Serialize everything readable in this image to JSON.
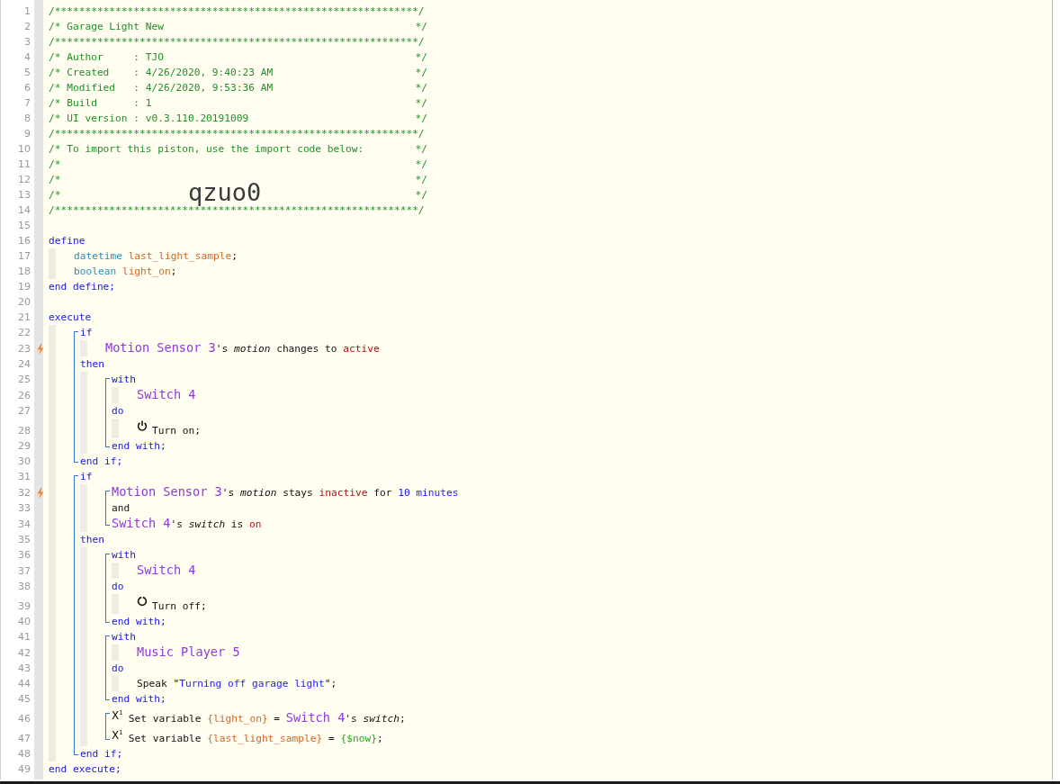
{
  "lines": [
    {
      "kind": "comment",
      "number": "1",
      "text": "/************************************************************/"
    },
    {
      "kind": "comment",
      "number": "2",
      "text": "/* Garage Light New",
      "close": "*/"
    },
    {
      "kind": "comment",
      "number": "3",
      "text": "/************************************************************/"
    },
    {
      "kind": "comment",
      "number": "4",
      "text": "/* Author     : TJO",
      "close": "*/"
    },
    {
      "kind": "comment",
      "number": "5",
      "text": "/* Created    : 4/26/2020, 9:40:23 AM",
      "close": "*/"
    },
    {
      "kind": "comment",
      "number": "6",
      "text": "/* Modified   : 4/26/2020, 9:53:36 AM",
      "close": "*/"
    },
    {
      "kind": "comment",
      "number": "7",
      "text": "/* Build      : 1",
      "close": "*/"
    },
    {
      "kind": "comment",
      "number": "8",
      "text": "/* UI version : v0.3.110.20191009",
      "close": "*/"
    },
    {
      "kind": "comment",
      "number": "9",
      "text": "/************************************************************/"
    },
    {
      "kind": "comment",
      "number": "10",
      "text": "/* To import this piston, use the import code below:",
      "close": "*/"
    },
    {
      "kind": "comment",
      "number": "11",
      "text": "/*",
      "close": "*/"
    },
    {
      "kind": "comment",
      "number": "12",
      "text": "/*",
      "close": "*/"
    },
    {
      "kind": "comment",
      "number": "13",
      "text": "/*",
      "close": "*/",
      "import_code": "qzuo0"
    },
    {
      "kind": "comment",
      "number": "14",
      "text": "/************************************************************/"
    },
    {
      "kind": "blank",
      "number": "15"
    },
    {
      "kind": "code",
      "number": "16",
      "tokens": [
        {
          "kind": "keyword",
          "text": "define"
        }
      ],
      "children": [
        {
          "kind": "code",
          "number": "17",
          "tokens": [
            {
              "kind": "type",
              "text": "datetime "
            },
            {
              "kind": "variable",
              "text": "last_light_sample"
            },
            {
              "kind": "plain",
              "text": ";"
            }
          ]
        },
        {
          "kind": "code",
          "number": "18",
          "tokens": [
            {
              "kind": "type",
              "text": "boolean "
            },
            {
              "kind": "variable",
              "text": "light_on"
            },
            {
              "kind": "plain",
              "text": ";"
            }
          ]
        }
      ]
    },
    {
      "kind": "code",
      "number": "19",
      "tokens": [
        {
          "kind": "keyword",
          "text": "end define;"
        }
      ]
    },
    {
      "kind": "blank",
      "number": "20"
    },
    {
      "kind": "code",
      "number": "21",
      "tokens": [
        {
          "kind": "keyword",
          "text": "execute"
        }
      ],
      "children": [
        {
          "kind": "block",
          "lines": [
            {
              "kind": "code",
              "number": "22",
              "tokens": [
                {
                  "kind": "keyword",
                  "text": "if"
                }
              ],
              "children": [
                {
                  "kind": "code",
                  "number": "23",
                  "trigger": true,
                  "tokens": [
                    {
                      "kind": "device",
                      "text": "Motion Sensor 3"
                    },
                    {
                      "kind": "plain",
                      "text": "'s "
                    },
                    {
                      "kind": "attribute",
                      "text": "motion"
                    },
                    {
                      "kind": "plain",
                      "text": " changes to "
                    },
                    {
                      "kind": "value",
                      "text": "active"
                    }
                  ]
                }
              ]
            },
            {
              "kind": "code",
              "number": "24",
              "tokens": [
                {
                  "kind": "keyword",
                  "text": "then"
                }
              ],
              "children": [
                {
                  "kind": "block",
                  "lines": [
                    {
                      "kind": "code",
                      "number": "25",
                      "tokens": [
                        {
                          "kind": "keyword",
                          "text": "with"
                        }
                      ],
                      "children": [
                        {
                          "kind": "code",
                          "number": "26",
                          "tokens": [
                            {
                              "kind": "device",
                              "text": "Switch 4"
                            }
                          ]
                        }
                      ]
                    },
                    {
                      "kind": "code",
                      "number": "27",
                      "tokens": [
                        {
                          "kind": "keyword",
                          "text": "do"
                        }
                      ],
                      "children": [
                        {
                          "kind": "code",
                          "number": "28",
                          "power_on": true,
                          "tokens": [
                            {
                              "kind": "plain",
                              "text": "Turn on;"
                            }
                          ]
                        }
                      ]
                    },
                    {
                      "kind": "code",
                      "number": "29",
                      "tokens": [
                        {
                          "kind": "keyword",
                          "text": "end with;"
                        }
                      ]
                    }
                  ]
                }
              ]
            },
            {
              "kind": "code",
              "number": "30",
              "tokens": [
                {
                  "kind": "keyword",
                  "text": "end if;"
                }
              ]
            }
          ]
        },
        {
          "kind": "block",
          "lines": [
            {
              "kind": "code",
              "number": "31",
              "tokens": [
                {
                  "kind": "keyword",
                  "text": "if"
                }
              ],
              "children": [
                {
                  "kind": "block",
                  "lines": [
                    {
                      "kind": "code",
                      "number": "32",
                      "trigger": true,
                      "tokens": [
                        {
                          "kind": "device",
                          "text": "Motion Sensor 3"
                        },
                        {
                          "kind": "plain",
                          "text": "'s "
                        },
                        {
                          "kind": "attribute",
                          "text": "motion"
                        },
                        {
                          "kind": "plain",
                          "text": " stays "
                        },
                        {
                          "kind": "value",
                          "text": "inactive"
                        },
                        {
                          "kind": "plain",
                          "text": " for "
                        },
                        {
                          "kind": "number",
                          "text": "10 minutes"
                        }
                      ]
                    },
                    {
                      "kind": "code",
                      "number": "33",
                      "tokens": [
                        {
                          "kind": "plain",
                          "text": "and"
                        }
                      ]
                    },
                    {
                      "kind": "code",
                      "number": "34",
                      "tokens": [
                        {
                          "kind": "device",
                          "text": "Switch 4"
                        },
                        {
                          "kind": "plain",
                          "text": "'s "
                        },
                        {
                          "kind": "attribute",
                          "text": "switch"
                        },
                        {
                          "kind": "plain",
                          "text": " is "
                        },
                        {
                          "kind": "value",
                          "text": "on"
                        }
                      ]
                    }
                  ]
                }
              ]
            },
            {
              "kind": "code",
              "number": "35",
              "tokens": [
                {
                  "kind": "keyword",
                  "text": "then"
                }
              ],
              "children": [
                {
                  "kind": "block",
                  "lines": [
                    {
                      "kind": "code",
                      "number": "36",
                      "tokens": [
                        {
                          "kind": "keyword",
                          "text": "with"
                        }
                      ],
                      "children": [
                        {
                          "kind": "code",
                          "number": "37",
                          "tokens": [
                            {
                              "kind": "device",
                              "text": "Switch 4"
                            }
                          ]
                        }
                      ]
                    },
                    {
                      "kind": "code",
                      "number": "38",
                      "tokens": [
                        {
                          "kind": "keyword",
                          "text": "do"
                        }
                      ],
                      "children": [
                        {
                          "kind": "code",
                          "number": "39",
                          "power_on": false,
                          "tokens": [
                            {
                              "kind": "plain",
                              "text": "Turn off;"
                            }
                          ]
                        }
                      ]
                    },
                    {
                      "kind": "code",
                      "number": "40",
                      "tokens": [
                        {
                          "kind": "keyword",
                          "text": "end with;"
                        }
                      ]
                    }
                  ]
                },
                {
                  "kind": "block",
                  "lines": [
                    {
                      "kind": "code",
                      "number": "41",
                      "tokens": [
                        {
                          "kind": "keyword",
                          "text": "with"
                        }
                      ],
                      "children": [
                        {
                          "kind": "code",
                          "number": "42",
                          "tokens": [
                            {
                              "kind": "device",
                              "text": "Music Player 5"
                            }
                          ]
                        }
                      ]
                    },
                    {
                      "kind": "code",
                      "number": "43",
                      "tokens": [
                        {
                          "kind": "keyword",
                          "text": "do"
                        }
                      ],
                      "children": [
                        {
                          "kind": "code",
                          "number": "44",
                          "tokens": [
                            {
                              "kind": "plain",
                              "text": "Speak \""
                            },
                            {
                              "kind": "string",
                              "text": "Turning off garage light"
                            },
                            {
                              "kind": "plain",
                              "text": "\";"
                            }
                          ]
                        }
                      ]
                    },
                    {
                      "kind": "code",
                      "number": "45",
                      "tokens": [
                        {
                          "kind": "keyword",
                          "text": "end with;"
                        }
                      ]
                    }
                  ]
                },
                {
                  "kind": "block",
                  "lines": [
                    {
                      "kind": "code",
                      "number": "46",
                      "symbol": "X$^{1}$",
                      "tokens": [
                        {
                          "kind": "plain",
                          "text": "Set variable "
                        },
                        {
                          "kind": "variable",
                          "text": "{light_on}"
                        },
                        {
                          "kind": "plain",
                          "text": " = "
                        },
                        {
                          "kind": "device",
                          "text": "Switch 4"
                        },
                        {
                          "kind": "plain",
                          "text": "'s "
                        },
                        {
                          "kind": "attribute",
                          "text": "switch"
                        },
                        {
                          "kind": "plain",
                          "text": ";"
                        }
                      ]
                    },
                    {
                      "kind": "code",
                      "number": "47",
                      "symbol": "X$^{1}$",
                      "tokens": [
                        {
                          "kind": "plain",
                          "text": "Set variable "
                        },
                        {
                          "kind": "variable",
                          "text": "{last_light_sample}"
                        },
                        {
                          "kind": "plain",
                          "text": " = "
                        },
                        {
                          "kind": "system",
                          "text": "{$now}"
                        },
                        {
                          "kind": "plain",
                          "text": ";"
                        }
                      ]
                    }
                  ]
                }
              ]
            },
            {
              "kind": "code",
              "number": "48",
              "tokens": [
                {
                  "kind": "keyword",
                  "text": "end if;"
                }
              ]
            }
          ]
        }
      ]
    },
    {
      "kind": "code",
      "number": "49",
      "tokens": [
        {
          "kind": "keyword",
          "text": "end execute;"
        }
      ]
    }
  ]
}
